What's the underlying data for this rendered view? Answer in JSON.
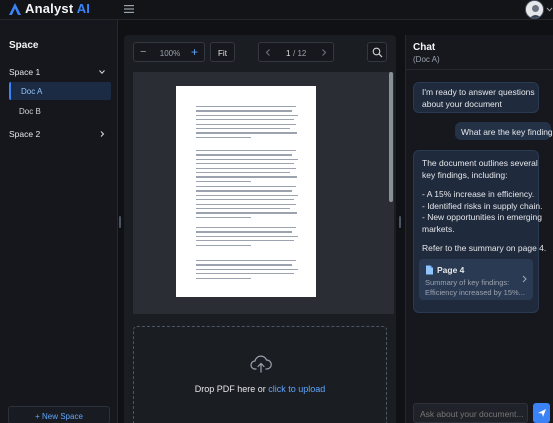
{
  "header": {
    "brand_prefix": "Analyst ",
    "brand_suffix": "AI",
    "logo_icon": "triangle-logo-icon",
    "menu_icon": "hamburger-icon",
    "avatar_icon": "user-avatar"
  },
  "sidebar": {
    "title": "Space",
    "spaces": [
      {
        "label": "Space 1",
        "expanded": true,
        "docs": [
          {
            "label": "Doc A",
            "active": true
          },
          {
            "label": "Doc B",
            "active": false
          }
        ]
      },
      {
        "label": "Space 2",
        "expanded": false,
        "docs": []
      }
    ],
    "new_space_label": "+ New Space"
  },
  "viewer": {
    "zoom_minus": "−",
    "zoom_value": "100%",
    "zoom_plus": "+",
    "fit_label": "Fit",
    "page_current": "1",
    "page_total": "/ 12",
    "search_icon": "search-icon"
  },
  "dropzone": {
    "text": "Drop PDF here or ",
    "link": "click to upload",
    "icon": "cloud-upload-icon"
  },
  "chat": {
    "title": "Chat",
    "subtitle": "(Doc A)",
    "messages": {
      "ai_greeting": [
        "I'm ready to answer questions",
        "about your document"
      ],
      "user_question": "What are the key findings?",
      "ai_answer": [
        "The document outlines several",
        "key findings, including:",
        "- A 15% increase in efficiency.",
        "- Identified risks in supply chain.",
        "- New opportunities in emerging",
        "markets.",
        "Refer to the summary on page 4."
      ]
    },
    "citation": {
      "title": "Page 4",
      "snippet_1": "Summary of key findings:",
      "snippet_2": "Efficiency increased by 15%..."
    },
    "input_placeholder": "Ask about your document...",
    "send_icon": "send-icon"
  },
  "colors": {
    "accent": "#3b82f6",
    "background": "#0f1115",
    "panel": "#1a1d22"
  }
}
